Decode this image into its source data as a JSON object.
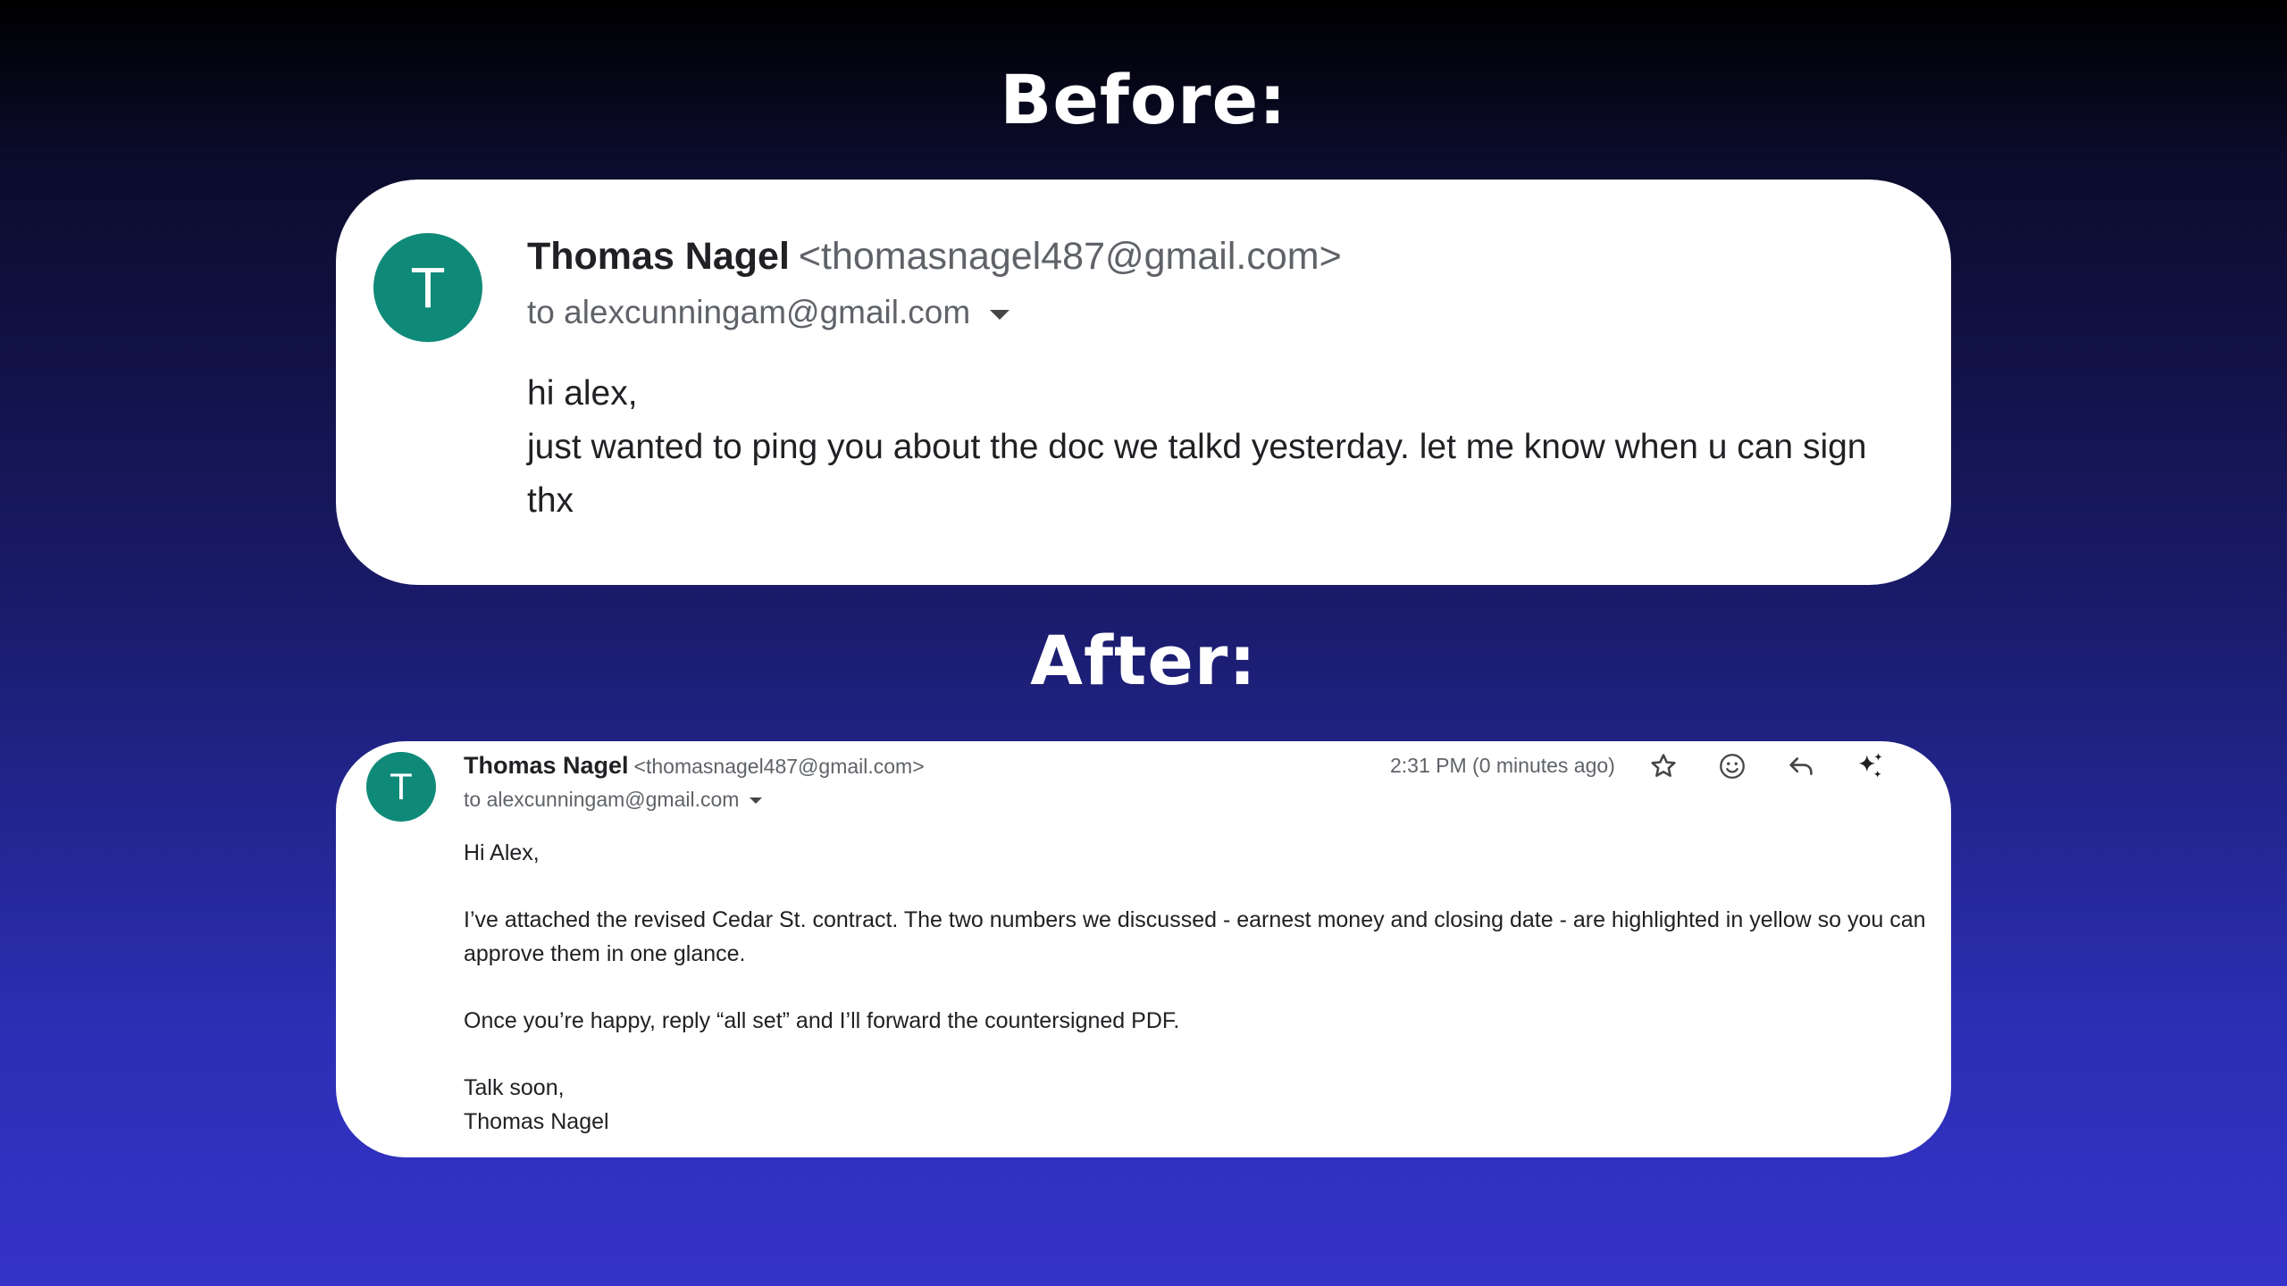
{
  "before": {
    "heading": "Before:",
    "email": {
      "avatar_letter": "T",
      "sender_name": "Thomas Nagel",
      "sender_email": "<thomasnagel487@gmail.com>",
      "to": "to alexcunningam@gmail.com",
      "body_lines": [
        "hi alex,",
        "just wanted to ping you about the doc we talkd yesterday. let me know when u can sign",
        "thx"
      ]
    }
  },
  "after": {
    "heading": "After:",
    "email": {
      "avatar_letter": "T",
      "sender_name": "Thomas Nagel",
      "sender_email": "<thomasnagel487@gmail.com>",
      "to": "to alexcunningam@gmail.com",
      "timestamp": "2:31 PM (0 minutes ago)",
      "icons": [
        "star-icon",
        "emoji-icon",
        "reply-icon",
        "sparkle-icon"
      ],
      "greeting": "Hi Alex,",
      "paragraph1": "I’ve attached the revised Cedar St. contract. The two numbers we discussed - earnest money and closing date - are highlighted in yellow so you can approve them in one glance.",
      "paragraph2": "Once you’re happy, reply “all set” and I’ll forward the countersigned PDF.",
      "signoff": "Talk soon,",
      "signature": "Thomas Nagel"
    }
  },
  "colors": {
    "avatar": "#0f8a79",
    "card": "#ffffff",
    "text_primary": "#202124",
    "text_secondary": "#5f6368"
  }
}
